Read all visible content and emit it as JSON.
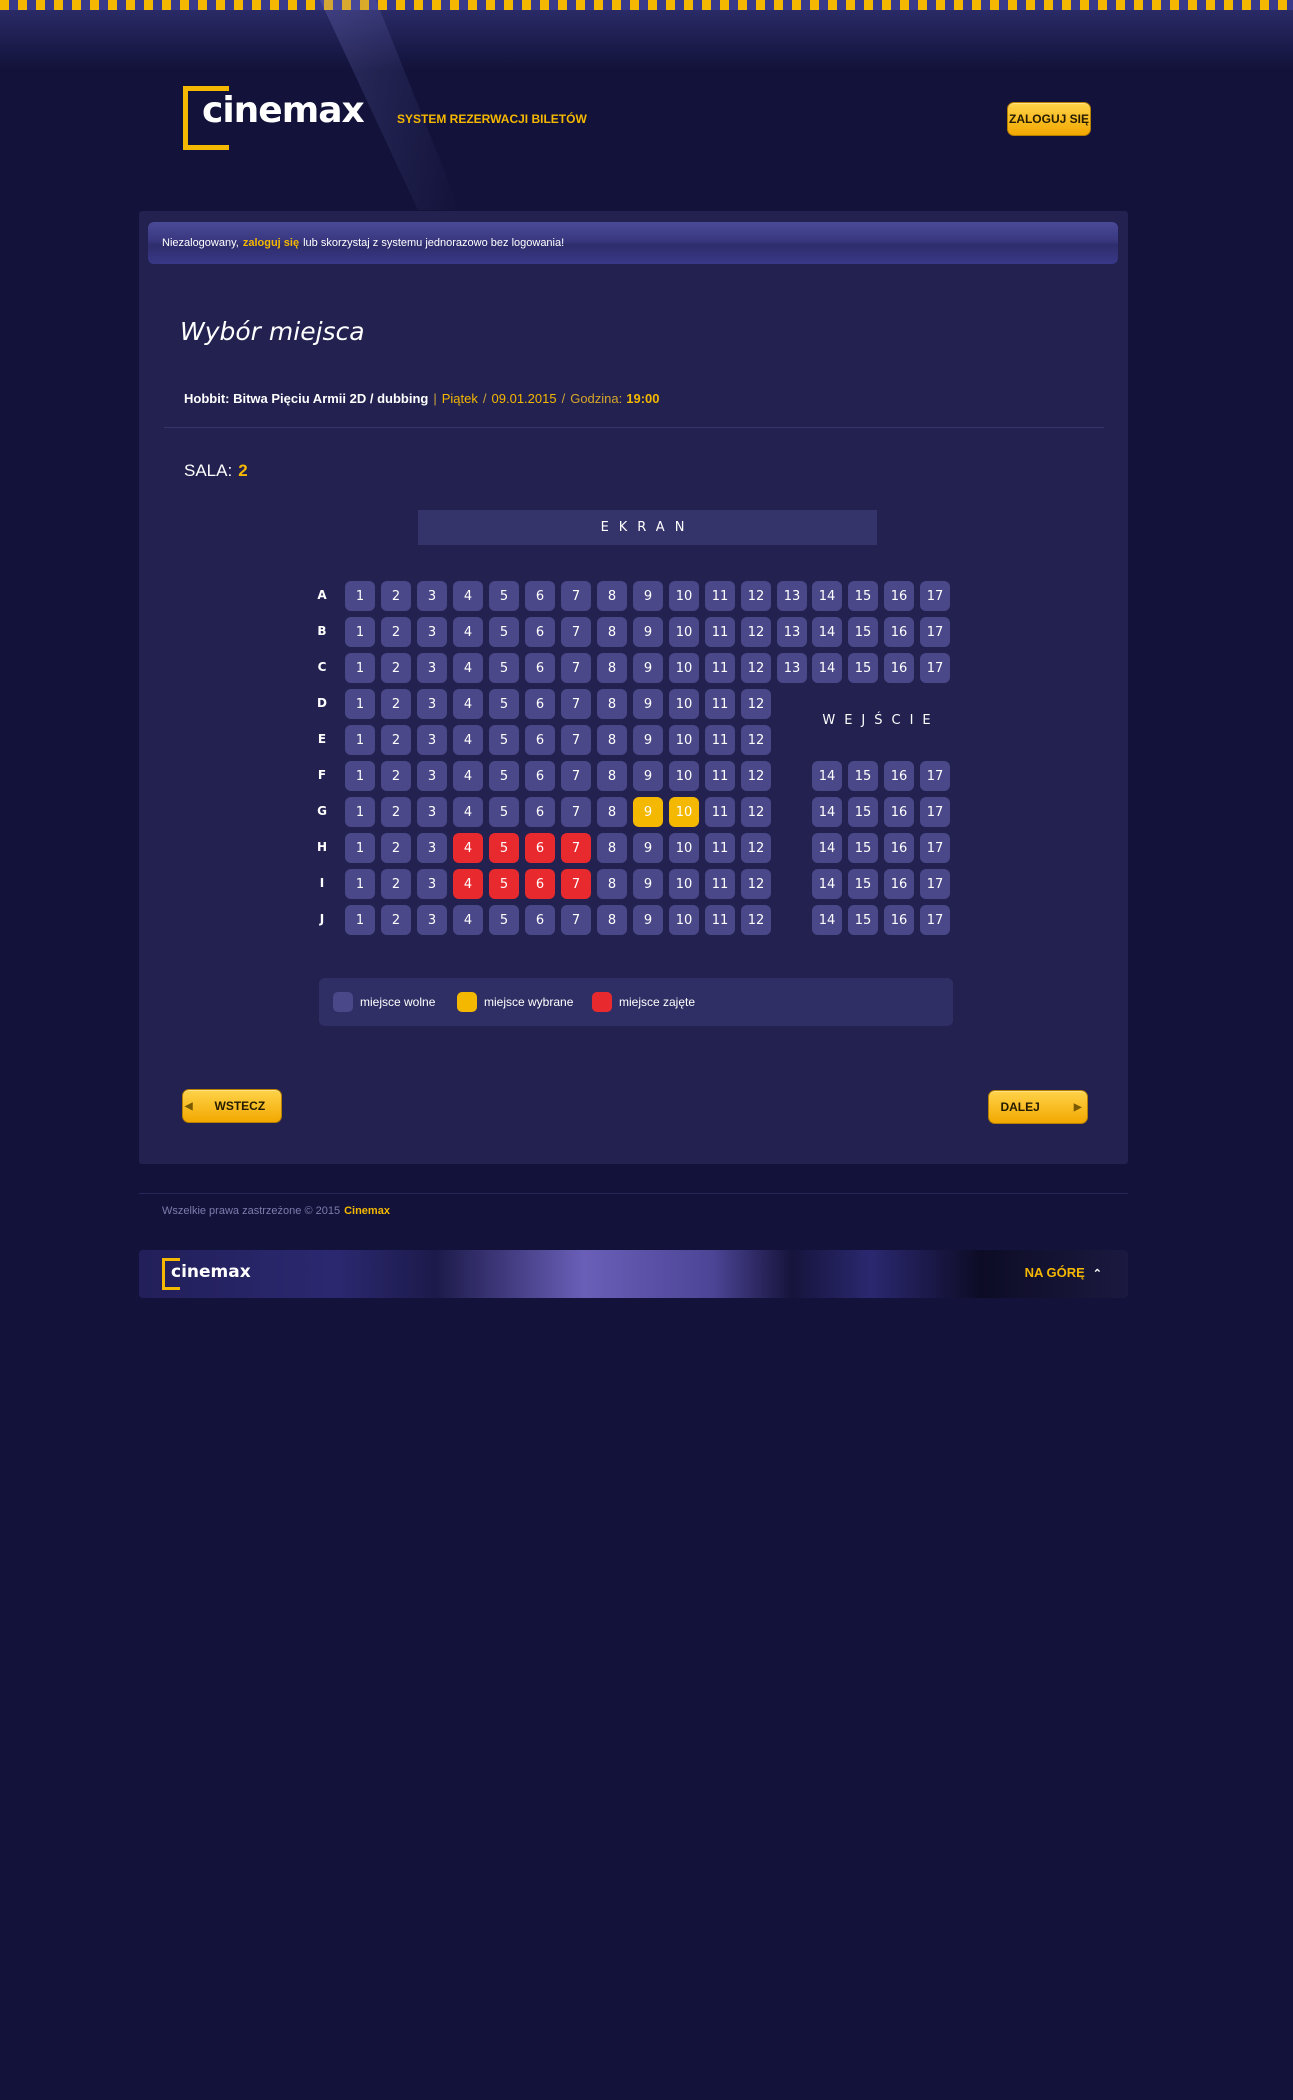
{
  "header": {
    "logo_text": "cinemax",
    "tagline": "SYSTEM REZERWACJI BILETÓW",
    "login_label": "ZALOGUJ SIĘ"
  },
  "notice": {
    "before": "Niezalogowany,",
    "link": "zaloguj się",
    "after": "lub skorzystaj z systemu jednorazowo bez logowania!"
  },
  "page_title": "Wybór miejsca",
  "movie": {
    "title": "Hobbit: Bitwa Pięciu Armii 2D / dubbing",
    "sep1": "|",
    "day": "Piątek",
    "sep2": "/",
    "date": "09.01.2015",
    "sep3": "/",
    "time_label": "Godzina:",
    "time": "19:00"
  },
  "hall": {
    "label": "SALA:",
    "number": "2"
  },
  "screen_label": "EKRAN",
  "entrance_label": "WEJŚCIE",
  "rows": [
    {
      "label": "A",
      "left": [
        1,
        2,
        3,
        4,
        5,
        6,
        7,
        8,
        9,
        10,
        11,
        12,
        13
      ],
      "right": [
        14,
        15,
        16,
        17
      ],
      "selected": [],
      "taken": []
    },
    {
      "label": "B",
      "left": [
        1,
        2,
        3,
        4,
        5,
        6,
        7,
        8,
        9,
        10,
        11,
        12,
        13
      ],
      "right": [
        14,
        15,
        16,
        17
      ],
      "selected": [],
      "taken": []
    },
    {
      "label": "C",
      "left": [
        1,
        2,
        3,
        4,
        5,
        6,
        7,
        8,
        9,
        10,
        11,
        12,
        13
      ],
      "right": [
        14,
        15,
        16,
        17
      ],
      "selected": [],
      "taken": []
    },
    {
      "label": "D",
      "left": [
        1,
        2,
        3,
        4,
        5,
        6,
        7,
        8,
        9,
        10,
        11,
        12
      ],
      "right": [],
      "selected": [],
      "taken": []
    },
    {
      "label": "E",
      "left": [
        1,
        2,
        3,
        4,
        5,
        6,
        7,
        8,
        9,
        10,
        11,
        12
      ],
      "right": [],
      "selected": [],
      "taken": []
    },
    {
      "label": "F",
      "left": [
        1,
        2,
        3,
        4,
        5,
        6,
        7,
        8,
        9,
        10,
        11,
        12
      ],
      "right": [
        14,
        15,
        16,
        17
      ],
      "selected": [],
      "taken": []
    },
    {
      "label": "G",
      "left": [
        1,
        2,
        3,
        4,
        5,
        6,
        7,
        8,
        9,
        10,
        11,
        12
      ],
      "right": [
        14,
        15,
        16,
        17
      ],
      "selected": [
        9,
        10
      ],
      "taken": []
    },
    {
      "label": "H",
      "left": [
        1,
        2,
        3,
        4,
        5,
        6,
        7,
        8,
        9,
        10,
        11,
        12
      ],
      "right": [
        14,
        15,
        16,
        17
      ],
      "selected": [],
      "taken": [
        4,
        5,
        6,
        7
      ]
    },
    {
      "label": "I",
      "left": [
        1,
        2,
        3,
        4,
        5,
        6,
        7,
        8,
        9,
        10,
        11,
        12
      ],
      "right": [
        14,
        15,
        16,
        17
      ],
      "selected": [],
      "taken": [
        4,
        5,
        6,
        7
      ]
    },
    {
      "label": "J",
      "left": [
        1,
        2,
        3,
        4,
        5,
        6,
        7,
        8,
        9,
        10,
        11,
        12
      ],
      "right": [
        14,
        15,
        16,
        17
      ],
      "selected": [],
      "taken": []
    }
  ],
  "legend": {
    "free": "miejsce wolne",
    "selected": "miejsce wybrane",
    "taken": "miejsce zajęte"
  },
  "colors": {
    "free": "#4a4888",
    "selected": "#f5b800",
    "taken": "#e8292e",
    "accent": "#f5b800"
  },
  "nav": {
    "back_label": "WSTECZ",
    "next_label": "DALEJ"
  },
  "footer": {
    "copyright": "Wszelkie prawa zastrzeżone © 2015",
    "brand": "Cinemax",
    "logo_text": "cinemax",
    "to_top_label": "NA GÓRĘ"
  }
}
